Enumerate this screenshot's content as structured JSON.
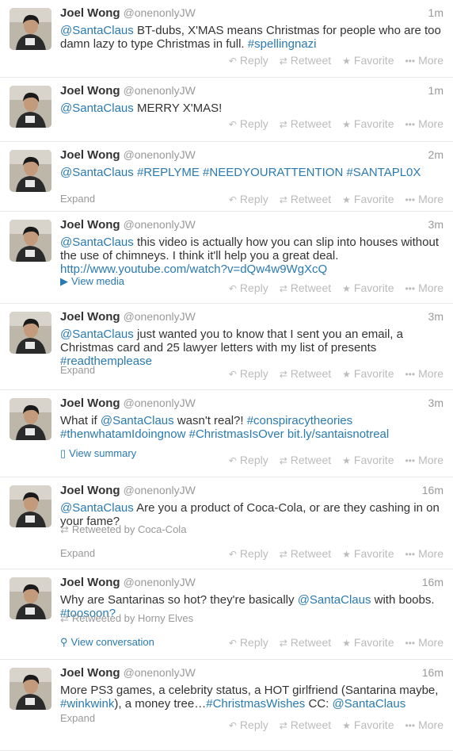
{
  "actions": {
    "reply": "Reply",
    "retweet": "Retweet",
    "favorite": "Favorite",
    "more": "More"
  },
  "tweets": [
    {
      "name": "Joel Wong",
      "handle": "@onenonlyJW",
      "time": "1m",
      "segments": [
        {
          "t": "@SantaClaus",
          "l": true
        },
        {
          "t": " BT-dubs, X'MAS means Christmas for people who are too damn lazy to type Christmas in full. "
        },
        {
          "t": "#spellingnazi",
          "l": true
        }
      ]
    },
    {
      "name": "Joel Wong",
      "handle": "@onenonlyJW",
      "time": "1m",
      "segments": [
        {
          "t": "@SantaClaus",
          "l": true
        },
        {
          "t": " MERRY X'MAS!"
        }
      ]
    },
    {
      "name": "Joel Wong",
      "handle": "@onenonlyJW",
      "time": "2m",
      "segments": [
        {
          "t": "@SantaClaus",
          "l": true
        },
        {
          "t": " "
        },
        {
          "t": "#REPLYME",
          "l": true
        },
        {
          "t": " "
        },
        {
          "t": "#NEEDYOURATTENTION",
          "l": true
        },
        {
          "t": " "
        },
        {
          "t": "#SANTAPL0X",
          "l": true
        }
      ],
      "expand": "Expand"
    },
    {
      "name": "Joel Wong",
      "handle": "@onenonlyJW",
      "time": "3m",
      "segments": [
        {
          "t": "@SantaClaus",
          "l": true
        },
        {
          "t": " this video is actually how you can slip into houses without the use of chimneys. I think it'll help you a great deal. "
        },
        {
          "t": "http://www.youtube.com/watch?v=dQw4w9WgXcQ",
          "l": true
        }
      ],
      "media": "View media"
    },
    {
      "name": "Joel Wong",
      "handle": "@onenonlyJW",
      "time": "3m",
      "segments": [
        {
          "t": "@SantaClaus",
          "l": true
        },
        {
          "t": " just wanted you to know that I sent you an email, a Christmas card and 25 lawyer letters with my list of presents "
        },
        {
          "t": "#readthemplease",
          "l": true
        }
      ],
      "expand": "Expand"
    },
    {
      "name": "Joel Wong",
      "handle": "@onenonlyJW",
      "time": "3m",
      "segments": [
        {
          "t": "What if "
        },
        {
          "t": "@SantaClaus",
          "l": true
        },
        {
          "t": " wasn't real?! "
        },
        {
          "t": "#conspiracytheories",
          "l": true
        },
        {
          "t": " "
        },
        {
          "t": "#thenwhatamIdoingnow",
          "l": true
        },
        {
          "t": " "
        },
        {
          "t": "#ChristmasIsOver",
          "l": true
        },
        {
          "t": " "
        },
        {
          "t": "bit.ly/santaisnotreal",
          "l": true
        }
      ],
      "summary": "View summary"
    },
    {
      "name": "Joel Wong",
      "handle": "@onenonlyJW",
      "time": "16m",
      "segments": [
        {
          "t": "@SantaClaus",
          "l": true
        },
        {
          "t": " Are you a product of Coca-Cola, or are they cashing in on your fame?"
        }
      ],
      "retweeted": "Retweeted by Coca-Cola",
      "expand": "Expand"
    },
    {
      "name": "Joel Wong",
      "handle": "@onenonlyJW",
      "time": "16m",
      "segments": [
        {
          "t": "Why are Santarinas so hot? they're basically "
        },
        {
          "t": "@SantaClaus",
          "l": true
        },
        {
          "t": " with boobs. "
        },
        {
          "t": "#toosoon?",
          "l": true
        }
      ],
      "retweeted": "Retweeted by Horny Elves",
      "conversation": "View conversation"
    },
    {
      "name": "Joel Wong",
      "handle": "@onenonlyJW",
      "time": "16m",
      "segments": [
        {
          "t": "More PS3 games, a celebrity status, a HOT girlfriend (Santarina maybe, "
        },
        {
          "t": "#winkwink",
          "l": true
        },
        {
          "t": "), a money tree…"
        },
        {
          "t": "#ChristmasWishes",
          "l": true
        },
        {
          "t": " CC: "
        },
        {
          "t": "@SantaClaus",
          "l": true
        }
      ],
      "expand": "Expand"
    }
  ]
}
